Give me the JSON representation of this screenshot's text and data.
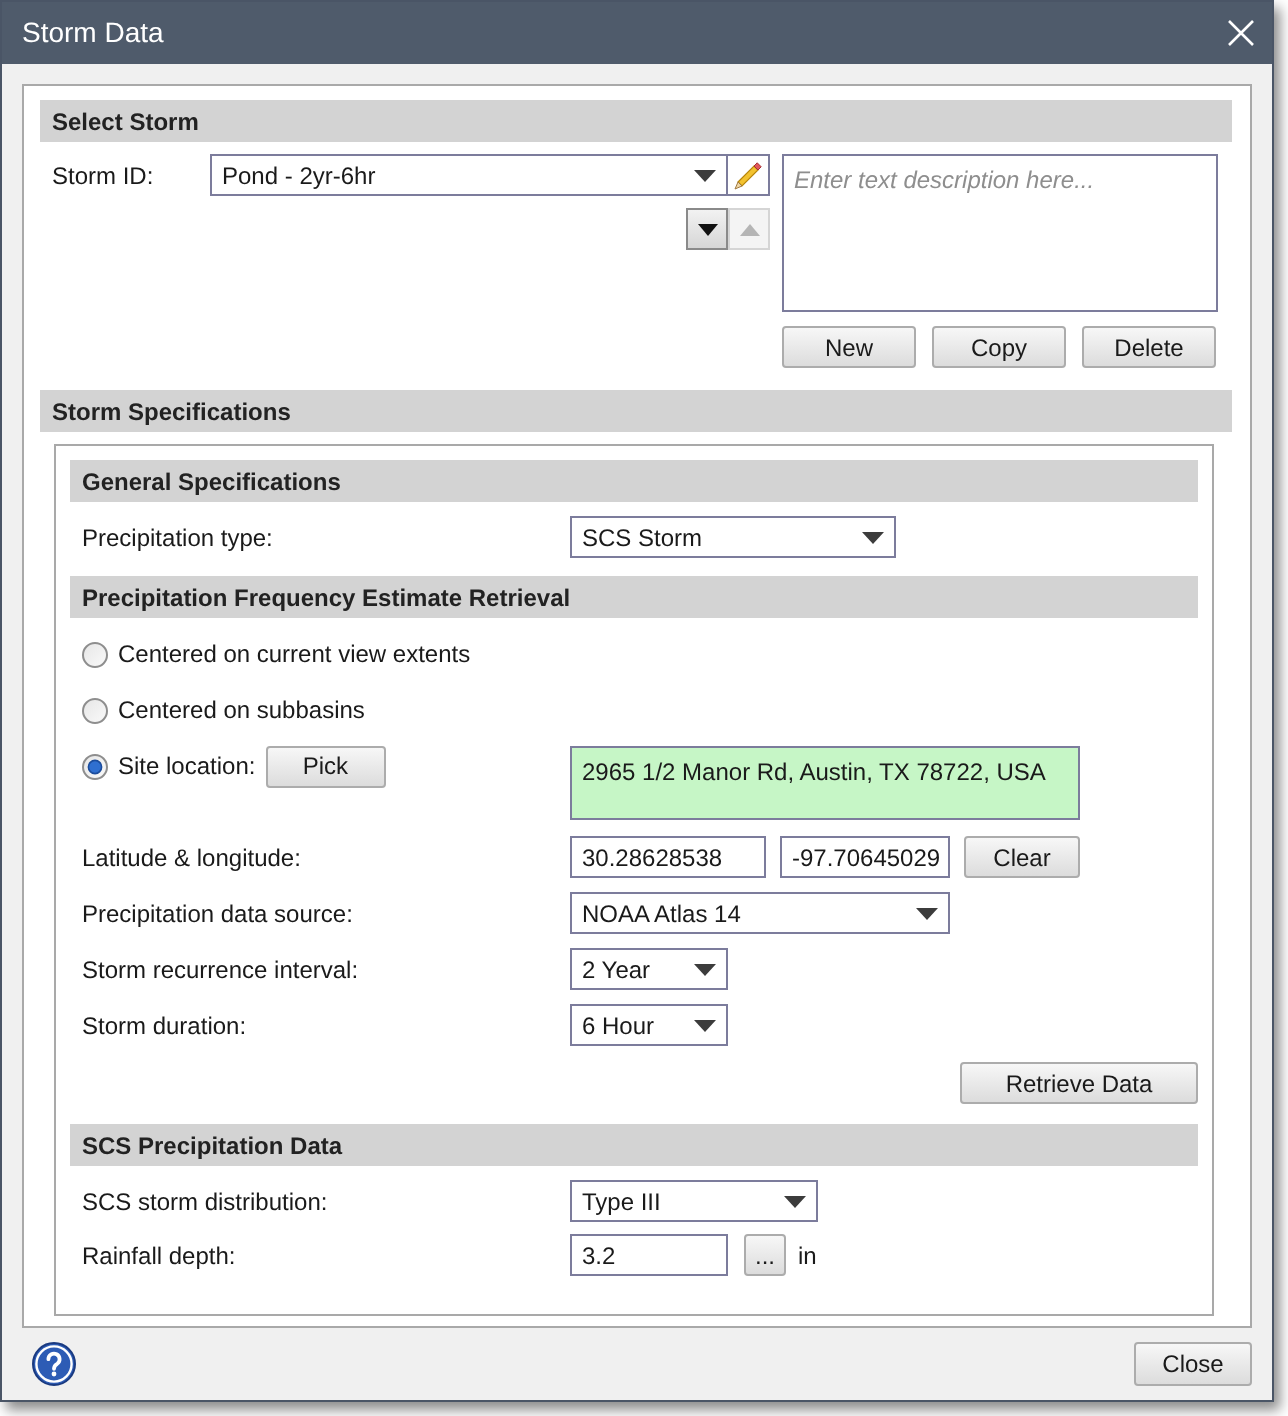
{
  "window": {
    "title": "Storm Data"
  },
  "select_storm": {
    "header": "Select Storm",
    "storm_id": {
      "label": "Storm ID:",
      "value": "Pond - 2yr-6hr"
    },
    "move_down": {
      "disabled": false
    },
    "move_up": {
      "disabled": true
    },
    "description": {
      "placeholder": "Enter text description here..."
    },
    "buttons": [
      "New",
      "Copy",
      "Delete"
    ]
  },
  "storm_specifications": {
    "header": "Storm Specifications",
    "sections": [
      {
        "header": "General Specifications",
        "rows": [
          {
            "kind": "dropdown",
            "label": "Precipitation type:",
            "value": "SCS Storm"
          }
        ]
      },
      {
        "header": "Precipitation Frequency Estimate Retrieval",
        "options": [
          {
            "kind": "plain",
            "label": "Centered on current view extents",
            "selected": false
          },
          {
            "kind": "plain",
            "label": "Centered on subbasins",
            "selected": false
          },
          {
            "kind": "site",
            "label": "Site location:",
            "selected": true,
            "button": "Pick",
            "address": "2965 1/2 Manor Rd, Austin, TX 78722, USA"
          }
        ],
        "rows": [
          {
            "kind": "pair",
            "label": "Latitude & longitude:",
            "values": [
              "30.28628538",
              "-97.70645029"
            ],
            "button": "Clear"
          },
          {
            "kind": "dropdown",
            "label": "Precipitation data source:",
            "value": "NOAA Atlas 14"
          },
          {
            "kind": "dropdown",
            "label": "Storm recurrence interval:",
            "value": "2 Year"
          },
          {
            "kind": "dropdown",
            "label": "Storm duration:",
            "value": "6 Hour"
          }
        ],
        "action_button": "Retrieve Data"
      },
      {
        "header": "SCS Precipitation Data",
        "rows": [
          {
            "kind": "dropdown",
            "label": "SCS storm distribution:",
            "value": "Type III"
          },
          {
            "kind": "number",
            "label": "Rainfall depth:",
            "value": "3.2",
            "button": "...",
            "unit": "in"
          }
        ]
      }
    ]
  },
  "footer": {
    "close_button": "Close"
  }
}
